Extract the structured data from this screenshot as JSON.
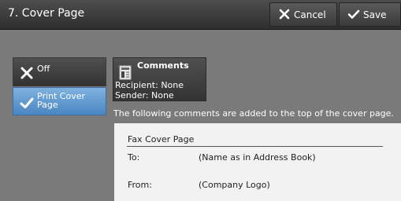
{
  "header": {
    "title": "7. Cover Page",
    "cancel_label": "Cancel",
    "save_label": "Save",
    "cancel_icon": "x-icon",
    "save_icon": "check-icon"
  },
  "options": {
    "off_label": "Off",
    "print_label_line1": "Print Cover",
    "print_label_line2": "Page",
    "selected": "Print Cover Page"
  },
  "comments": {
    "label": "Comments",
    "recipient": "Recipient: None",
    "sender": "Sender: None"
  },
  "note": "The following comments are added to the top of the cover page.",
  "preview": {
    "title": "Fax Cover Page",
    "to_label": "To:",
    "to_value": "(Name as in Address Book)",
    "from_label": "From:",
    "from_value": "(Company Logo)"
  },
  "colors": {
    "background": "#7a7a7a",
    "header": "#3a3a3a",
    "selected": "#5b95cf",
    "paper": "#f2f2f2"
  }
}
